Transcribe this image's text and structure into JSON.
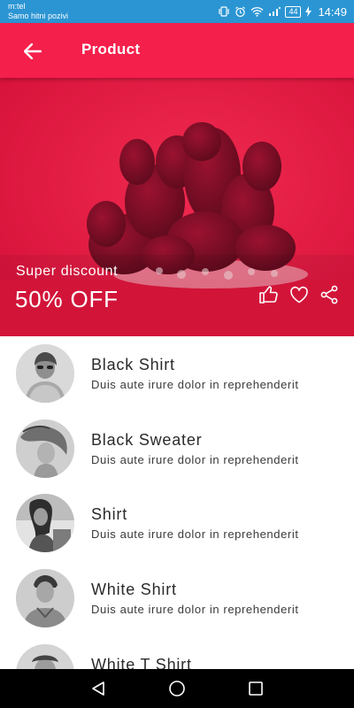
{
  "status_bar": {
    "carrier": "m:tel",
    "carrier_note": "Samo hitni pozivi",
    "battery": "44",
    "time": "14:49"
  },
  "app_bar": {
    "title": "Product",
    "back_icon": "arrow-left-icon"
  },
  "hero": {
    "subtitle": "Super discount",
    "title": "50% OFF",
    "actions": [
      "thumbs-up-icon",
      "heart-icon",
      "share-icon"
    ]
  },
  "products": [
    {
      "name": "Black Shirt",
      "description": "Duis aute irure dolor in reprehenderit"
    },
    {
      "name": "Black Sweater",
      "description": "Duis aute irure dolor in reprehenderit"
    },
    {
      "name": "Shirt",
      "description": "Duis aute irure dolor in reprehenderit"
    },
    {
      "name": "White Shirt",
      "description": "Duis aute irure dolor in reprehenderit"
    },
    {
      "name": "White T Shirt",
      "description": ""
    }
  ],
  "nav_bar": {
    "icons": [
      "back-triangle-icon",
      "home-circle-icon",
      "recents-square-icon"
    ]
  },
  "colors": {
    "status_bar": "#2b95d3",
    "app_bar": "#f41f4b",
    "hero": "#e8173f",
    "nav_bar": "#000000"
  }
}
